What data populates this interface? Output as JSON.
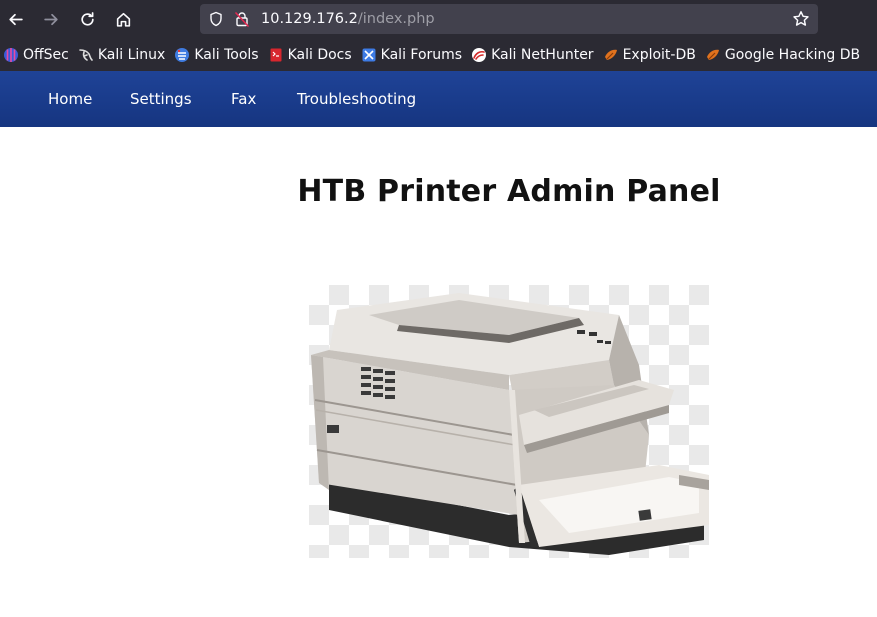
{
  "browser": {
    "url_host": "10.129.176.2",
    "url_path": "/index.php",
    "bookmarks": [
      {
        "label": "OffSec",
        "icon": "offsec-icon"
      },
      {
        "label": "Kali Linux",
        "icon": "kali-dragon-icon"
      },
      {
        "label": "Kali Tools",
        "icon": "kali-tools-icon"
      },
      {
        "label": "Kali Docs",
        "icon": "kali-docs-icon"
      },
      {
        "label": "Kali Forums",
        "icon": "kali-forums-icon"
      },
      {
        "label": "Kali NetHunter",
        "icon": "kali-nethunter-icon"
      },
      {
        "label": "Exploit-DB",
        "icon": "exploit-db-icon"
      },
      {
        "label": "Google Hacking DB",
        "icon": "ghdb-icon"
      }
    ]
  },
  "site": {
    "nav": [
      {
        "label": "Home"
      },
      {
        "label": "Settings"
      },
      {
        "label": "Fax"
      },
      {
        "label": "Troubleshooting"
      }
    ],
    "title": "HTB Printer Admin Panel",
    "image_icon": "printer-image",
    "colors": {
      "nav_bg": "#1a3c8c",
      "chrome_bg": "#2b2a33",
      "urlbar_bg": "#42414d"
    }
  }
}
